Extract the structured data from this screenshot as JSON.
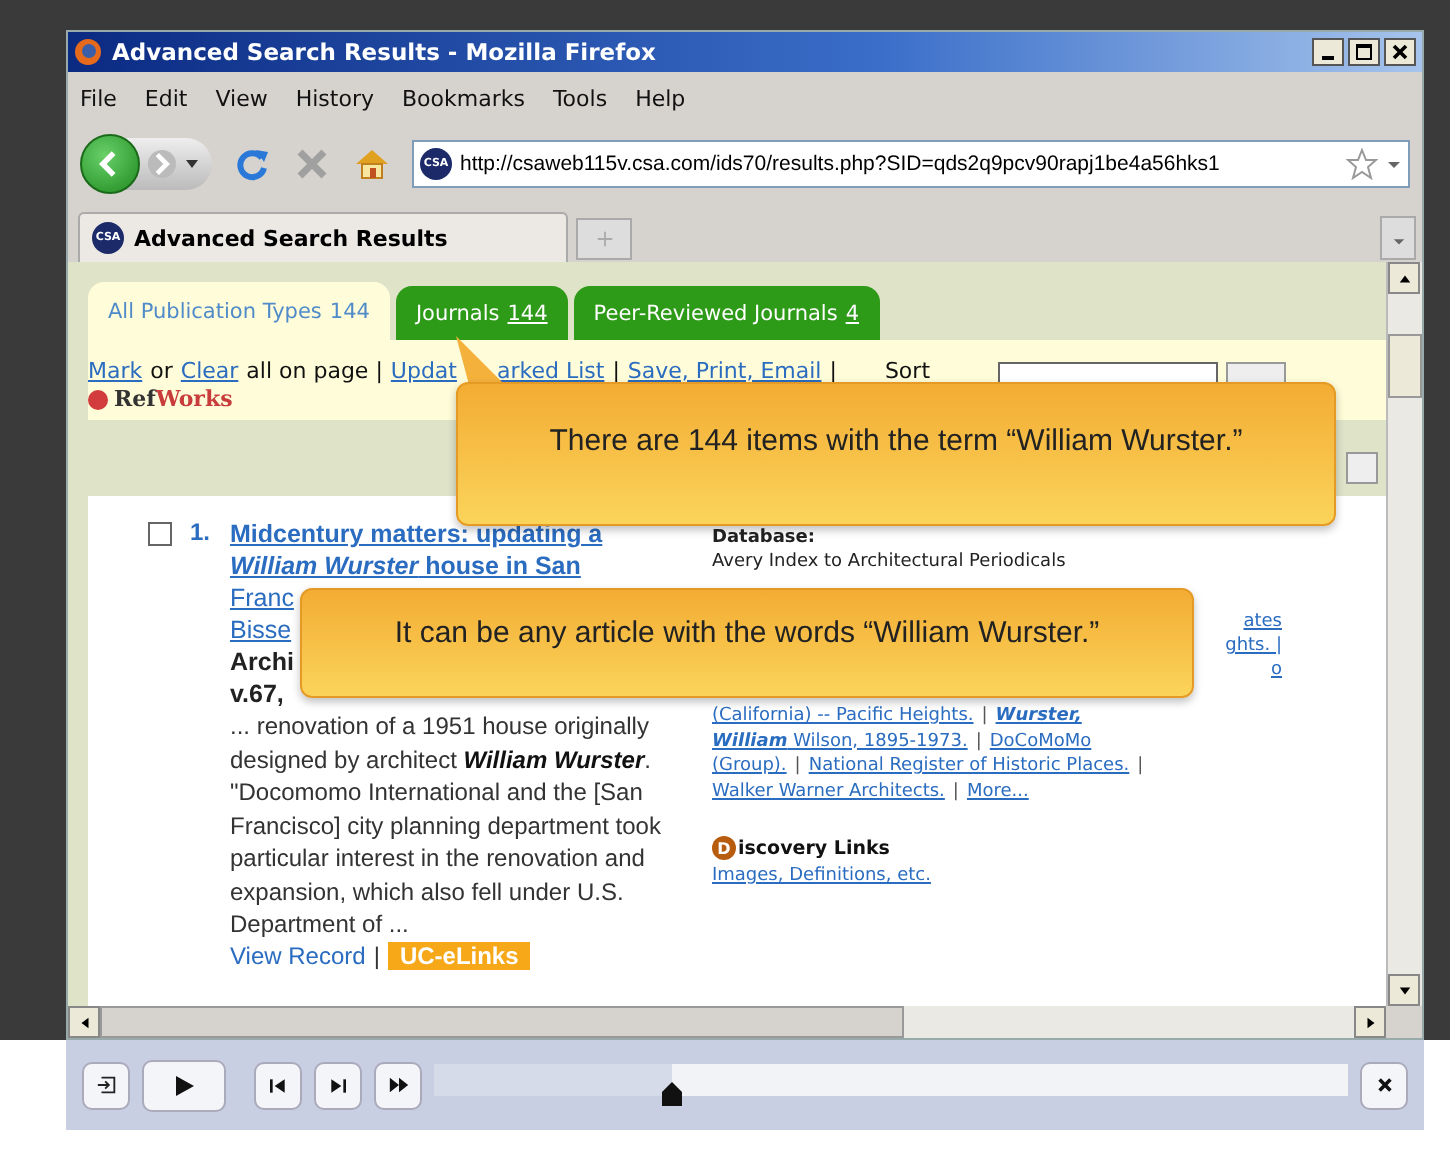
{
  "window": {
    "title": "Advanced Search Results - Mozilla Firefox"
  },
  "menu": [
    {
      "label": "File"
    },
    {
      "label": "Edit"
    },
    {
      "label": "View"
    },
    {
      "label": "History"
    },
    {
      "label": "Bookmarks"
    },
    {
      "label": "Tools"
    },
    {
      "label": "Help"
    }
  ],
  "address_bar": {
    "site_badge": "CSA",
    "url": "http://csaweb115v.csa.com/ids70/results.php?SID=qds2q9pcv90rapj1be4a56hks1"
  },
  "browser_tabs": [
    {
      "badge": "CSA",
      "label": "Advanced Search Results",
      "selected": true
    }
  ],
  "result_tabs": [
    {
      "label": "All Publication Types",
      "count": "144",
      "selected": true
    },
    {
      "label": "Journals",
      "count": "144",
      "selected": false
    },
    {
      "label": "Peer-Reviewed Journals",
      "count": "4",
      "selected": false
    }
  ],
  "toolbar": {
    "mark": "Mark",
    "or": "or",
    "clear": "Clear",
    "all_on_page": "all on page |",
    "update_start": "Updat",
    "update_end": "arked List",
    "separator_1": "|",
    "save": "Save, Print, Email",
    "separator_2": "|",
    "sort": "Sort",
    "refworks_ref": "Ref",
    "refworks_works": "Works"
  },
  "callouts": [
    {
      "text": "There are 144 items with the term “William Wurster.”"
    },
    {
      "text": "It can be any article with the words “William Wurster.”"
    }
  ],
  "result": {
    "number": "1.",
    "checked": false,
    "title_lines": [
      "Midcentury matters: updating a",
      "*William Wurster* house in San"
    ],
    "fragments": [
      "Franc",
      "Bisse",
      "Archi",
      "v.67,"
    ],
    "snippet": "... renovation of a 1951 house originally designed by architect **William Wurster**. \"Docomomo International and the [San Francisco] city planning department took particular interest in the renovation and expansion, which also fell under U.S. Department of ...",
    "view_record": "View Record",
    "view_separator": "|",
    "uc_elinks": "UC-eLinks",
    "database_label": "Database:",
    "database": "Avery Index to Architectural Periodicals",
    "subject_fragments": [
      "ates",
      "ghts. |",
      "o"
    ],
    "subject_lines": [
      [
        {
          "kind": "link",
          "text": "(California) -- Pacific Heights."
        },
        {
          "kind": "separator",
          "text": "|"
        },
        {
          "kind": "link",
          "text": "**Wurster,**"
        }
      ],
      [
        {
          "kind": "link",
          "text": "**William** Wilson, 1895-1973."
        },
        {
          "kind": "separator",
          "text": "|"
        },
        {
          "kind": "link",
          "text": "DoCoMoMo"
        }
      ],
      [
        {
          "kind": "link",
          "text": "(Group)."
        },
        {
          "kind": "separator",
          "text": "|"
        },
        {
          "kind": "link",
          "text": "National Register of Historic Places."
        },
        {
          "kind": "separator",
          "text": "|"
        }
      ],
      [
        {
          "kind": "link",
          "text": "Walker Warner Architects."
        },
        {
          "kind": "separator",
          "text": "|"
        },
        {
          "kind": "link",
          "text": "More..."
        }
      ]
    ],
    "discovery_letter": "D",
    "discovery_title": "iscovery Links",
    "discovery_link": "Images, Definitions, etc."
  },
  "player": {
    "level": 0.26
  }
}
